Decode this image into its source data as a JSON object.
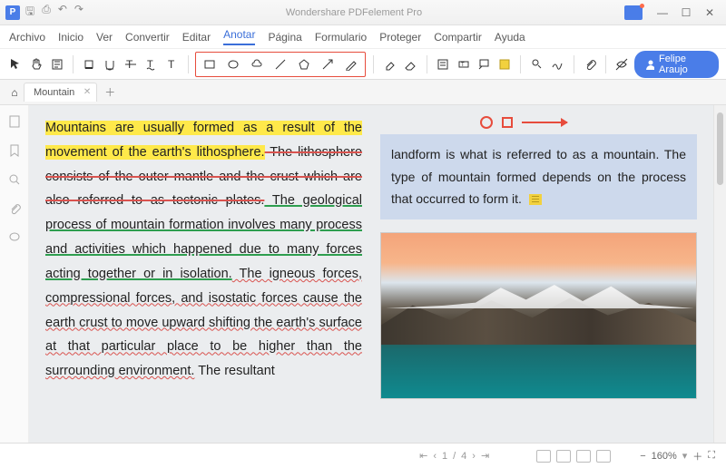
{
  "app": {
    "title": "Wondershare PDFelement Pro"
  },
  "menu": [
    "Archivo",
    "Inicio",
    "Ver",
    "Convertir",
    "Editar",
    "Anotar",
    "Página",
    "Formulario",
    "Proteger",
    "Compartir",
    "Ayuda"
  ],
  "menu_active_index": 5,
  "user": {
    "name": "Felipe Araujo"
  },
  "tab": {
    "name": "Mountain"
  },
  "doc": {
    "p1_hl": "Mountains are usually formed as a result of the movement of the earth's lithosphere.",
    "p1_strike": " The lithosphere consists of the outer mantle and the crust which are also referred to as tectonic plates.",
    "p1_under": " The geological process of mountain formation involves many process and activities which happened due to many forces acting together or in isolation.",
    "p1_wave": " The igneous forces, compressional forces, and isostatic forces cause the earth crust to move upward shifting the earth's surface at that particular place to be higher than the surrounding environment.",
    "p1_tail": " The resultant",
    "note": "landform is what is referred to as a mountain. The type of mountain formed depends on the process that occurred to form it."
  },
  "status": {
    "page_current": "1",
    "page_sep": "/",
    "page_total": "4",
    "zoom": "160%"
  }
}
